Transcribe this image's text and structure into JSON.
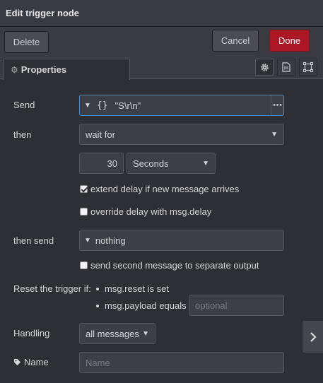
{
  "dialog": {
    "title": "Edit trigger node"
  },
  "toolbar": {
    "delete_label": "Delete",
    "cancel_label": "Cancel",
    "done_label": "Done"
  },
  "tabs": {
    "properties_label": "Properties"
  },
  "form": {
    "send": {
      "label": "Send",
      "type_glyph": "{}",
      "value": "\"S\\r\\n\""
    },
    "then": {
      "label": "then",
      "value": "wait for"
    },
    "duration": {
      "value": "30",
      "unit": "Seconds"
    },
    "extend_delay": {
      "label": "extend delay if new message arrives",
      "checked": true
    },
    "override_delay": {
      "label": "override delay with msg.delay",
      "checked": false
    },
    "then_send": {
      "label": "then send",
      "value": "nothing"
    },
    "second_output": {
      "label": "send second message to separate output",
      "checked": false
    },
    "reset": {
      "label": "Reset the trigger if:",
      "item1": "msg.reset is set",
      "item2": "msg.payload equals",
      "payload_placeholder": "optional"
    },
    "handling": {
      "label": "Handling",
      "value": "all messages"
    },
    "name": {
      "label": "Name",
      "placeholder": "Name"
    }
  },
  "colors": {
    "done_button": "#ad1625",
    "focus_border": "#4a8cd4",
    "background": "#2e2f33"
  }
}
